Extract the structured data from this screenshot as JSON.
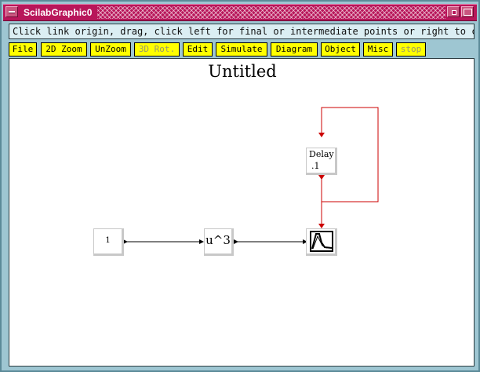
{
  "window": {
    "title": "ScilabGraphic0"
  },
  "info_message": "Click link origin, drag, click left for final or intermediate points or right to cancel",
  "toolbar": {
    "buttons": [
      "File",
      "2D Zoom",
      "UnZoom",
      "3D Rot.",
      "Edit",
      "Simulate",
      "Diagram",
      "Object",
      "Misc",
      "stop"
    ]
  },
  "diagram": {
    "title": "Untitled",
    "blocks": {
      "const": "1",
      "power": "u^3",
      "delay_line1": "Delay",
      "delay_line2": ".1",
      "scope_icon": "scope-icon"
    }
  },
  "colors": {
    "titlebar": "#b8165a",
    "frame": "#9ec6d2",
    "toolbar_button": "#ffff00",
    "link_regular": "#000000",
    "link_activation": "#cc0000"
  }
}
